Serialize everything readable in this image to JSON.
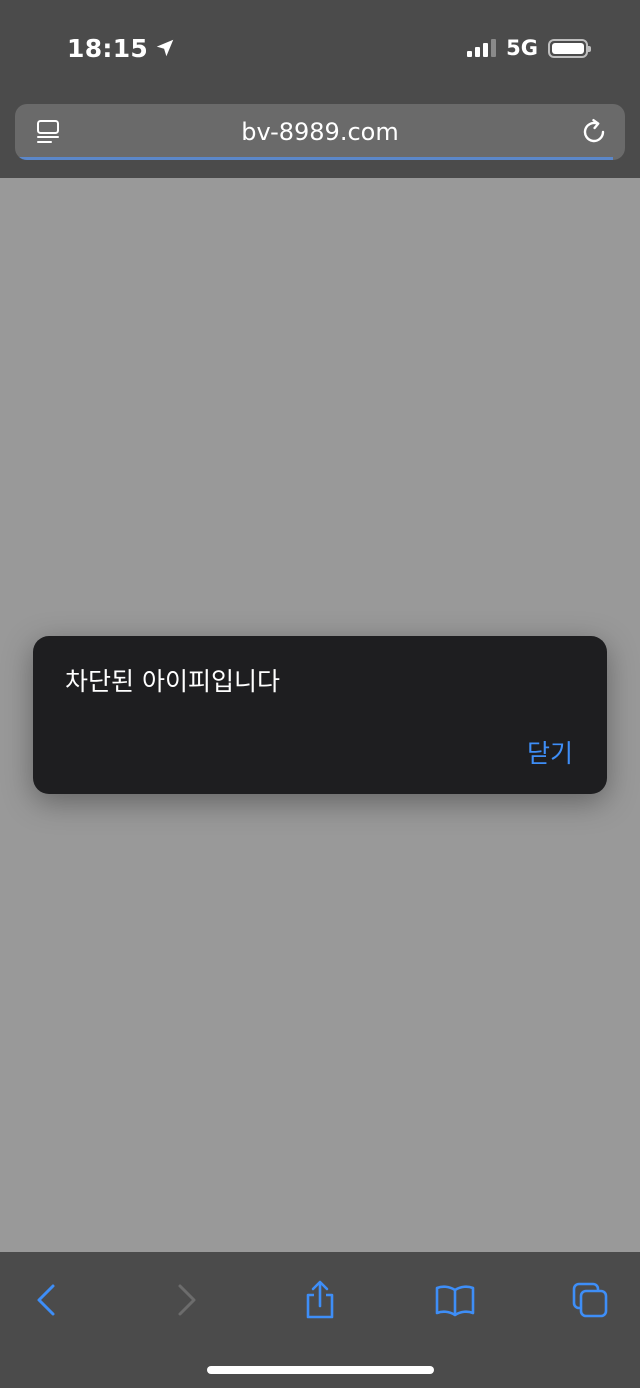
{
  "status_bar": {
    "time": "18:15",
    "network": "5G",
    "location_icon": "location-arrow-icon",
    "battery_level": 1.0
  },
  "url_bar": {
    "url": "bv-8989.com",
    "load_progress": 0.98,
    "left_icon": "reader-page-icon",
    "right_icon": "reload-icon"
  },
  "alert": {
    "message": "차단된 아이피입니다",
    "close_label": "닫기"
  },
  "toolbar": {
    "items": [
      "back-chevron-icon",
      "forward-chevron-icon",
      "share-icon",
      "bookmarks-book-icon",
      "tabs-icon"
    ]
  },
  "colors": {
    "accent": "#3e8ef7",
    "chrome": "#4b4b4b",
    "content": "#999999",
    "alert_bg": "#1e1e20"
  }
}
